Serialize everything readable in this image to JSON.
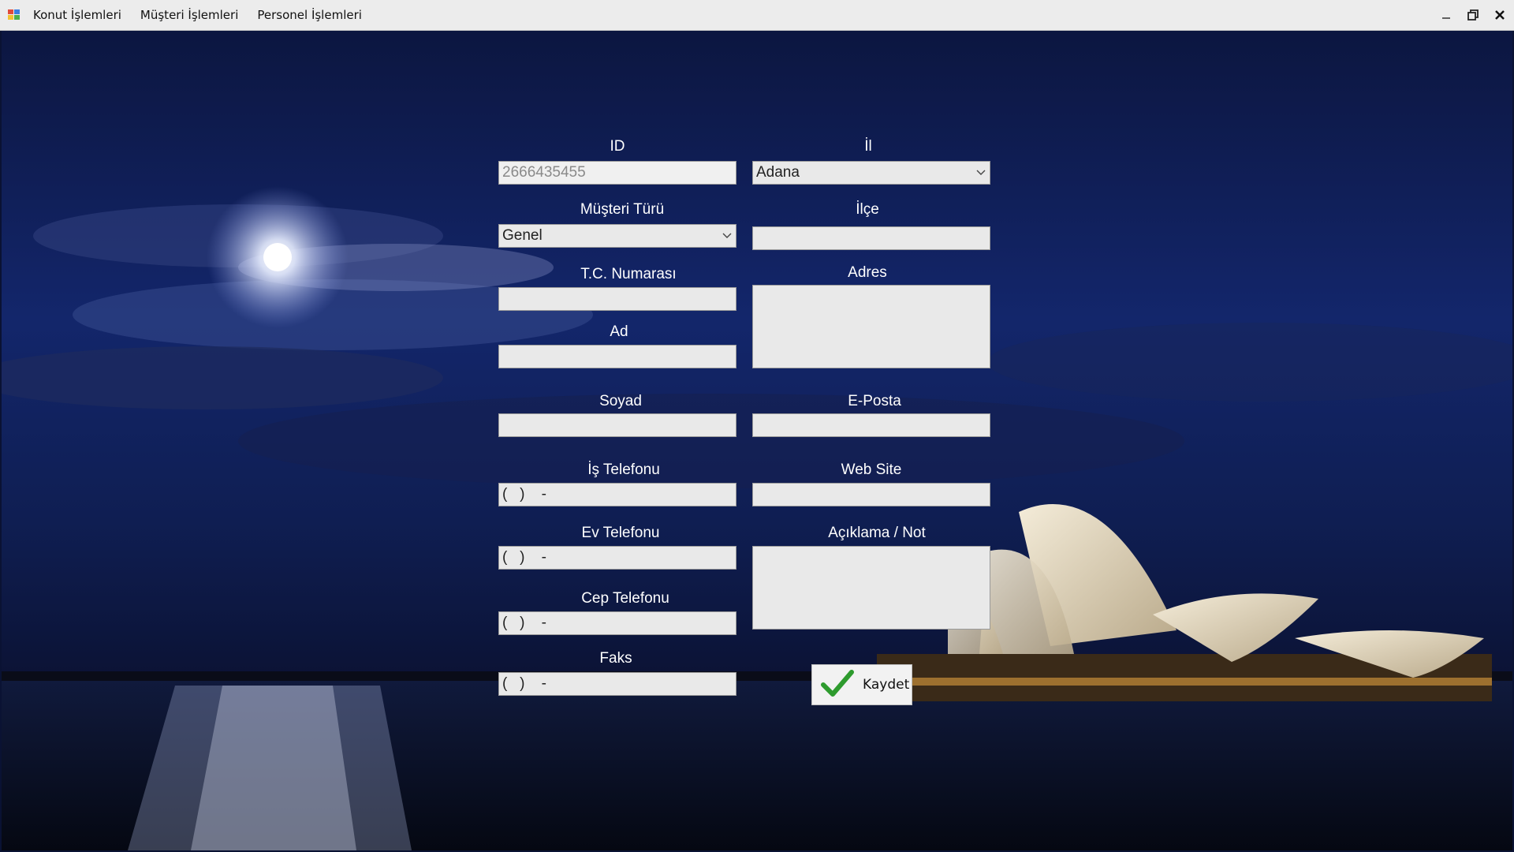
{
  "menu": {
    "items": [
      "Konut İşlemleri",
      "Müşteri İşlemleri",
      "Personel İşlemleri"
    ]
  },
  "form": {
    "id": {
      "label": "ID",
      "value": "2666435455"
    },
    "il": {
      "label": "İl",
      "value": "Adana"
    },
    "musteri_turu": {
      "label": "Müşteri Türü",
      "value": "Genel"
    },
    "ilce": {
      "label": "İlçe",
      "value": ""
    },
    "tc": {
      "label": "T.C. Numarası",
      "value": ""
    },
    "adres": {
      "label": "Adres",
      "value": ""
    },
    "ad": {
      "label": "Ad",
      "value": ""
    },
    "soyad": {
      "label": "Soyad",
      "value": ""
    },
    "eposta": {
      "label": "E-Posta",
      "value": ""
    },
    "is_telefonu": {
      "label": "İş Telefonu",
      "value": "(   )    -"
    },
    "web_site": {
      "label": "Web Site",
      "value": ""
    },
    "ev_telefonu": {
      "label": "Ev Telefonu",
      "value": "(   )    -"
    },
    "aciklama": {
      "label": "Açıklama / Not",
      "value": ""
    },
    "cep_telefonu": {
      "label": "Cep Telefonu",
      "value": "(   )    -"
    },
    "faks": {
      "label": "Faks",
      "value": "(   )    -"
    },
    "save_label": "Kaydet"
  },
  "icons": {
    "app": "app-icon",
    "minimize": "minimize-icon",
    "restore": "restore-icon",
    "close": "close-icon",
    "dropdown": "chevron-down-icon",
    "save": "checkmark-icon"
  },
  "colors": {
    "checkmark": "#2e9b2e",
    "background_sky": "#13266b"
  }
}
